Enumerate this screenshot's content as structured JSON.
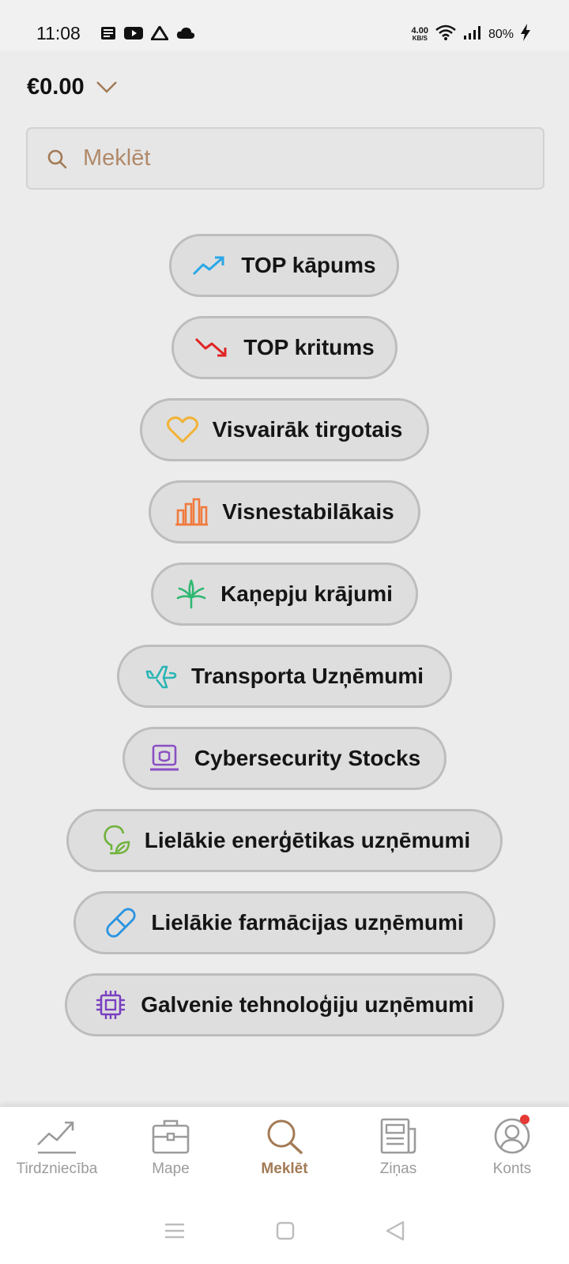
{
  "status": {
    "time": "11:08",
    "net_speed": "4.00",
    "net_unit": "KB/S",
    "battery": "80%"
  },
  "balance": {
    "amount": "€0.00"
  },
  "search": {
    "placeholder": "Meklēt"
  },
  "categories": [
    {
      "label": "TOP kāpums",
      "icon": "trending-up-icon",
      "color": "#2aa7e8"
    },
    {
      "label": "TOP kritums",
      "icon": "trending-down-icon",
      "color": "#e02424"
    },
    {
      "label": "Visvairāk tirgotais",
      "icon": "heart-icon",
      "color": "#f2b233"
    },
    {
      "label": "Visnestabilākais",
      "icon": "bar-chart-icon",
      "color": "#f07a3e"
    },
    {
      "label": "Kaņepju krājumi",
      "icon": "cannabis-leaf-icon",
      "color": "#2eb872"
    },
    {
      "label": "Transporta Uzņēmumi",
      "icon": "airplane-icon",
      "color": "#2bb5b5"
    },
    {
      "label": "Cybersecurity Stocks",
      "icon": "laptop-lock-icon",
      "color": "#8a4fc4"
    },
    {
      "label": "Lielākie enerģētikas uzņēmumi",
      "icon": "eco-bulb-icon",
      "color": "#6fb23a"
    },
    {
      "label": "Lielākie farmācijas uzņēmumi",
      "icon": "pill-icon",
      "color": "#2a94e0"
    },
    {
      "label": "Galvenie tehnoloģiju uzņēmumi",
      "icon": "cpu-chip-icon",
      "color": "#7a3fc0"
    }
  ],
  "nav": {
    "items": [
      {
        "label": "Tirdzniecība",
        "icon": "chart-line-icon"
      },
      {
        "label": "Mape",
        "icon": "briefcase-icon"
      },
      {
        "label": "Meklēt",
        "icon": "search-icon",
        "active": true
      },
      {
        "label": "Ziņas",
        "icon": "newspaper-icon"
      },
      {
        "label": "Konts",
        "icon": "account-icon"
      }
    ]
  },
  "colors": {
    "accent": "#a27a55",
    "background": "#ececec",
    "pill_bg": "#dedede",
    "notification": "#e53935"
  }
}
